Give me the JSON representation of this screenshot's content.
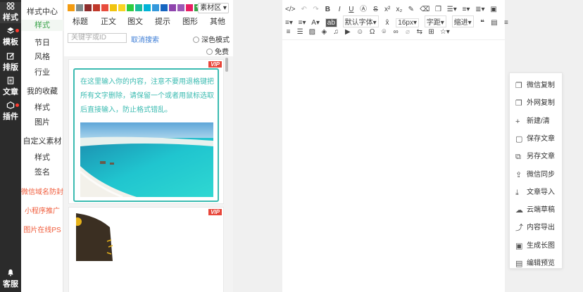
{
  "rail": {
    "items": [
      {
        "label": "样式",
        "icon": "grid-icon"
      },
      {
        "label": "模板",
        "icon": "layers-icon",
        "badge": true
      },
      {
        "label": "排版",
        "icon": "edit-icon"
      },
      {
        "label": "文章",
        "icon": "document-icon"
      },
      {
        "label": "插件",
        "icon": "plugin-icon",
        "badge": true
      }
    ],
    "service": "客服"
  },
  "subnav": {
    "style_center": "样式中心",
    "style": "样式",
    "festival": "节日",
    "flavor": "风格",
    "industry": "行业",
    "favorites": "我的收藏",
    "fav_style": "样式",
    "fav_image": "图片",
    "custom": "自定义素材",
    "custom_style": "样式",
    "custom_sign": "签名",
    "promo1": "微信域名防封",
    "promo2": "小程序推广",
    "promo3": "图片在线PS"
  },
  "panel": {
    "swatch_colors": [
      "#f39c12",
      "#7f8c8d",
      "#8e2c2c",
      "#c0392b",
      "#e84c3d",
      "#f1c40f",
      "#f9d423",
      "#2ecc40",
      "#1abc9c",
      "#00b4d8",
      "#3498db",
      "#1565c0",
      "#8e44ad",
      "#9b59b6",
      "#e91e63"
    ],
    "material_btn": "素材区",
    "categories": [
      "标题",
      "正文",
      "图文",
      "提示",
      "图形",
      "其他"
    ],
    "search_placeholder": "关键字或ID",
    "cancel_search": "取消搜索",
    "dark_mode": "深色模式",
    "free": "免费",
    "vip": "VIP",
    "card_text": "在这里输入你的内容，注意不要用退格键把所有文字删除，请保留一个或者用鼠标选取后直接输入，防止格式错乱。"
  },
  "toolbar": {
    "font_family": "默认字体",
    "font_size": "16px",
    "letter_spacing": "字距",
    "indent": "缩进"
  },
  "right_menu": [
    {
      "label": "微信复制",
      "icon": "copy-icon"
    },
    {
      "label": "外网复制",
      "icon": "copy-icon"
    },
    {
      "label": "新建/清",
      "icon": "plus-icon"
    },
    {
      "label": "保存文章",
      "icon": "save-icon"
    },
    {
      "label": "另存文章",
      "icon": "save-as-icon"
    },
    {
      "label": "微信同步",
      "icon": "upload-icon"
    },
    {
      "label": "文章导入",
      "icon": "import-icon"
    },
    {
      "label": "云端草稿",
      "icon": "cloud-icon"
    },
    {
      "label": "内容导出",
      "icon": "export-icon"
    },
    {
      "label": "生成长图",
      "icon": "image-icon"
    },
    {
      "label": "编辑预览",
      "icon": "preview-icon"
    }
  ]
}
